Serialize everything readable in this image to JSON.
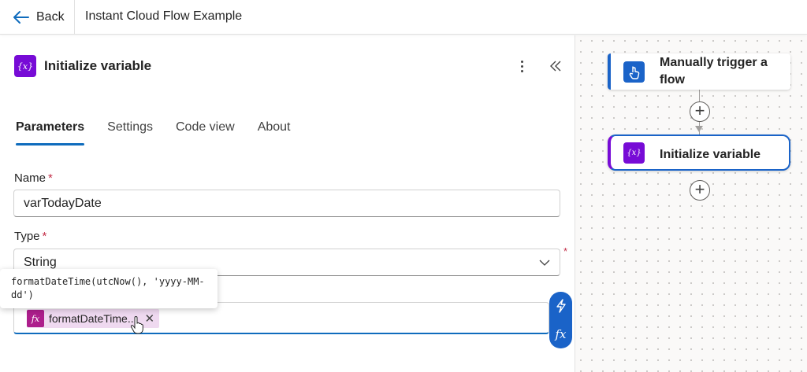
{
  "header": {
    "back_label": "Back",
    "flow_title": "Instant Cloud Flow Example"
  },
  "action_panel": {
    "icon_text": "{x}",
    "title": "Initialize variable",
    "tabs": [
      "Parameters",
      "Settings",
      "Code view",
      "About"
    ],
    "active_tab": "Parameters",
    "name_label": "Name",
    "name_value": "varTodayDate",
    "type_label": "Type",
    "type_value": "String",
    "required_marker": "*",
    "value_token": {
      "icon_text": "fx",
      "label": "formatDateTime...",
      "remove": "✕"
    },
    "tooltip": "formatDateTime(utcNow(), 'yyyy-MM-dd')",
    "side_buttons": [
      "lightning-icon",
      "fx-icon"
    ]
  },
  "canvas": {
    "trigger_card": {
      "title": "Manually trigger a flow",
      "icon": "hand-touch-icon"
    },
    "action_card": {
      "title": "Initialize variable",
      "icon_text": "{x}"
    },
    "add_symbol": "+"
  },
  "colors": {
    "accent_blue": "#0f6cbd",
    "variable_purple": "#770bd6",
    "expression_magenta": "#ad1e8c",
    "required_red": "#c4314b"
  }
}
